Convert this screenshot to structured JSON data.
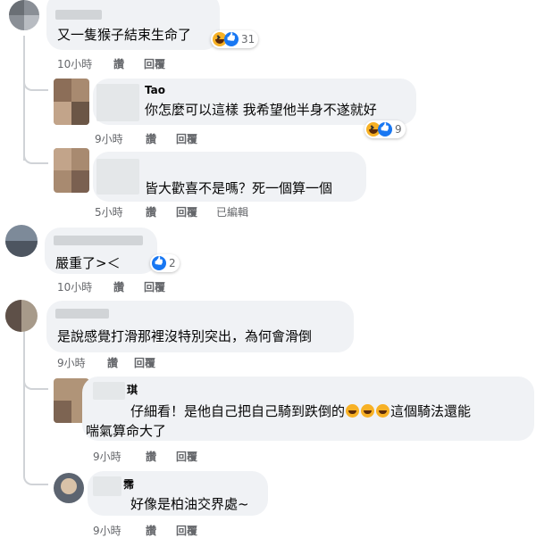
{
  "comments": [
    {
      "text": "又一隻猴子結束生命了",
      "reaction_count": "31",
      "time": "10小時",
      "like_label": "讚",
      "reply_label": "回覆"
    },
    {
      "author": "Tao",
      "text": "你怎麼可以這樣 我希望他半身不遂就好",
      "reaction_count": "9",
      "time": "9小時",
      "like_label": "讚",
      "reply_label": "回覆"
    },
    {
      "text": "皆大歡喜不是嗎？死一個算一個",
      "time": "5小時",
      "like_label": "讚",
      "reply_label": "回覆",
      "edited_label": "已編輯"
    },
    {
      "text": "嚴重了>＜",
      "reaction_count": "2",
      "time": "10小時",
      "like_label": "讚",
      "reply_label": "回覆"
    },
    {
      "text": "是說感覺打滑那裡沒特別突出，為何會滑倒",
      "time": "9小時",
      "like_label": "讚",
      "reply_label": "回覆"
    },
    {
      "author_fragment": "琪",
      "text_line1_a": "仔細看！是他自己把自己騎到跌倒的",
      "text_line1_b": "這個騎法還能",
      "text_line2": "喘氣算命大了",
      "time": "9小時",
      "like_label": "讚",
      "reply_label": "回覆"
    },
    {
      "author_fragment": "霈",
      "text": "好像是柏油交界處~",
      "time": "9小時",
      "like_label": "讚",
      "reply_label": "回覆"
    }
  ],
  "colors": {
    "bubble": "#f0f2f5",
    "meta_text": "#65676b",
    "like_blue": "#1877f2",
    "haha_yellow": "#f7b125"
  }
}
